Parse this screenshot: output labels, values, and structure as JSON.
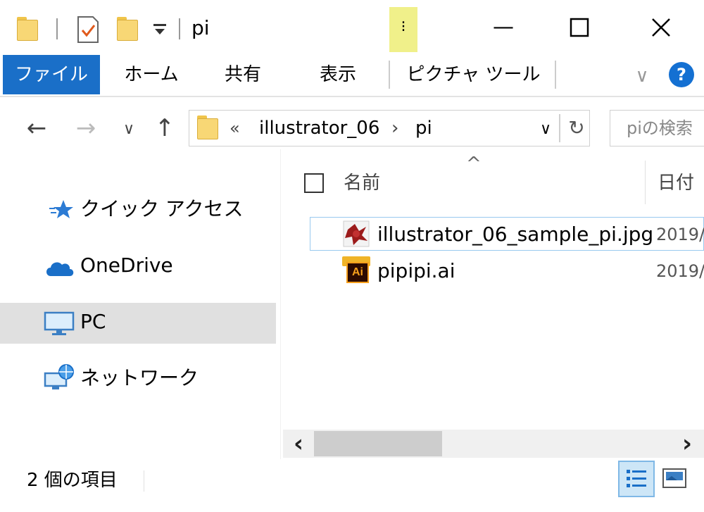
{
  "window": {
    "title": "pi",
    "min_glyph": "—",
    "max_glyph": "☐",
    "close_glyph": "✕",
    "customize_glyph": "⁝"
  },
  "ribbon": {
    "tabs": [
      {
        "label": "ファイル",
        "active": true
      },
      {
        "label": "ホーム"
      },
      {
        "label": "共有"
      },
      {
        "label": "表示"
      },
      {
        "label": "ピクチャ ツール"
      }
    ],
    "collapse_glyph": "∨",
    "help_glyph": "?"
  },
  "nav": {
    "back_glyph": "←",
    "forward_glyph": "→",
    "recent_glyph": "∨",
    "up_glyph": "↑",
    "breadcrumb_prefix": "«",
    "breadcrumb": [
      "illustrator_06",
      "pi"
    ],
    "breadcrumb_sep": "›",
    "dropdown_glyph": "∨",
    "refresh_glyph": "↻",
    "search_placeholder": "piの検索"
  },
  "sidebar": {
    "items": [
      {
        "label": "クイック アクセス",
        "icon": "star-icon"
      },
      {
        "label": "OneDrive",
        "icon": "cloud-icon"
      },
      {
        "label": "PC",
        "icon": "monitor-icon",
        "selected": true
      },
      {
        "label": "ネットワーク",
        "icon": "network-icon"
      }
    ]
  },
  "file_list": {
    "sort_glyph": "^",
    "columns": [
      "名前",
      "日付"
    ],
    "rows": [
      {
        "name": "illustrator_06_sample_pi.jpg",
        "date": "2019/",
        "icon": "jpg-file-icon"
      },
      {
        "name": "pipipi.ai",
        "date": "2019/",
        "icon": "ai-file-icon",
        "badge": "Ai"
      }
    ]
  },
  "scrollbar": {
    "left_glyph": "‹",
    "right_glyph": "›"
  },
  "status": {
    "item_count": "2 個の項目"
  },
  "colors": {
    "accent": "#1a6fc8",
    "selected_bg": "#e0e0e0",
    "highlight": "#f0f08a",
    "help_blue": "#1470d2"
  }
}
